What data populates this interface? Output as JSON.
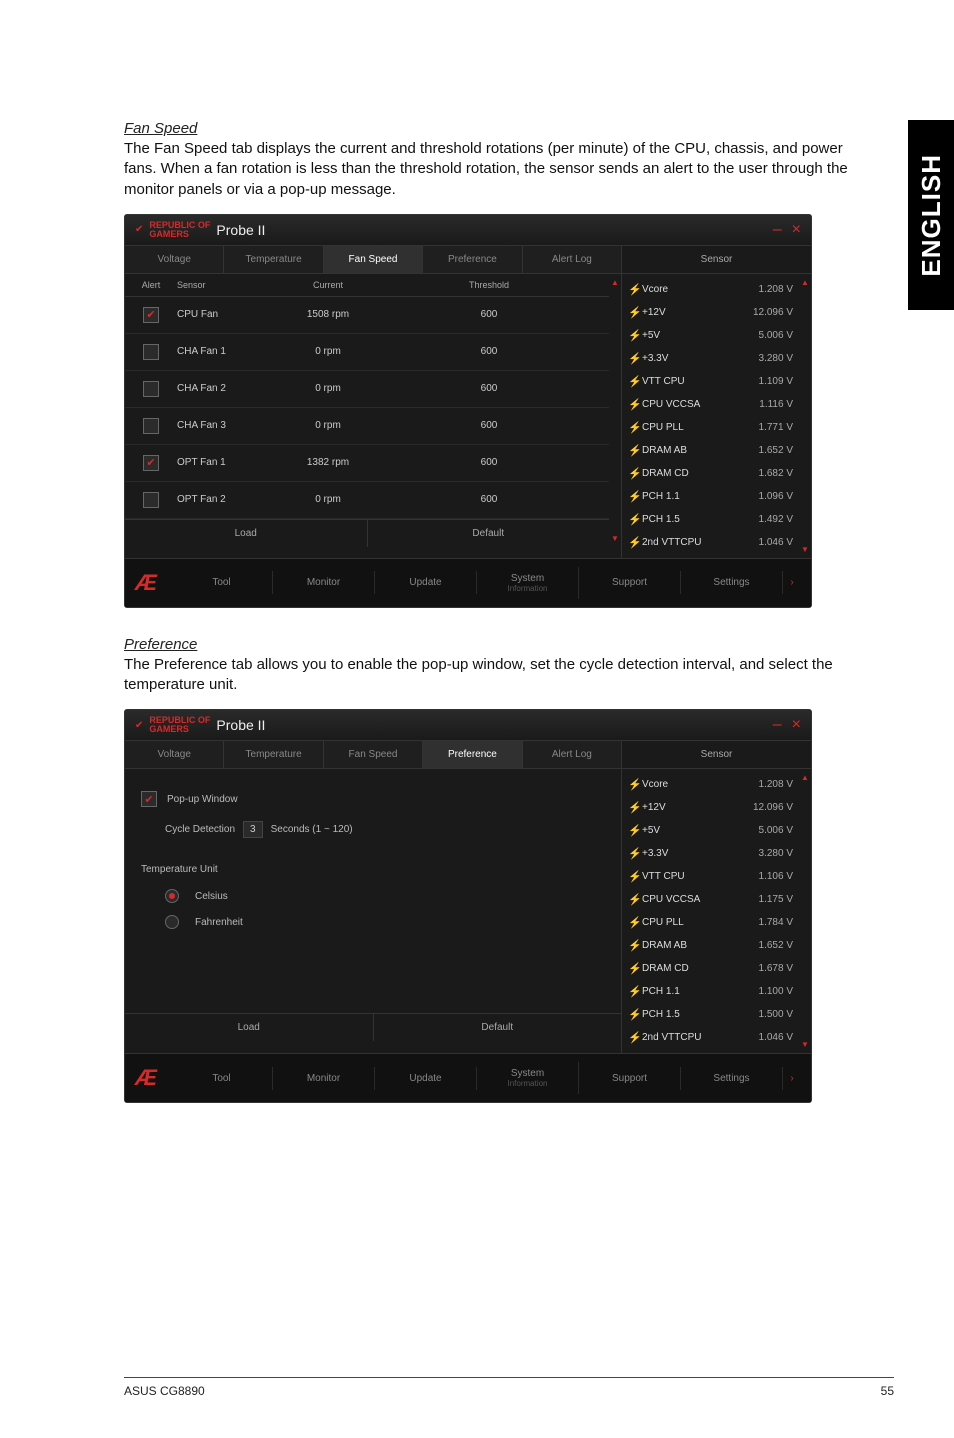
{
  "sidebar": {
    "label": "ENGLISH"
  },
  "fanSpeed": {
    "title": "Fan Speed",
    "description": "The Fan Speed tab displays the current and threshold rotations (per minute) of the CPU, chassis, and power fans. When a fan rotation is less than the threshold rotation, the sensor sends an alert to the user through the monitor panels or via a pop-up message."
  },
  "preference": {
    "title": "Preference",
    "description": "The Preference tab allows you to enable the pop-up window, set the cycle detection interval, and select the temperature unit."
  },
  "window": {
    "brand": "REPUBLIC OF\nGAMERS",
    "appTitle": "Probe II",
    "minLabel": "–",
    "closeLabel": "×"
  },
  "tabs": {
    "voltage": "Voltage",
    "temperature": "Temperature",
    "fanSpeed": "Fan Speed",
    "preference": "Preference",
    "alertLog": "Alert Log"
  },
  "fanGrid": {
    "headers": {
      "alert": "Alert",
      "sensor": "Sensor",
      "current": "Current",
      "threshold": "Threshold"
    },
    "rows": [
      {
        "checked": true,
        "sensor": "CPU Fan",
        "current": "1508 rpm",
        "threshold": "600"
      },
      {
        "checked": false,
        "sensor": "CHA Fan 1",
        "current": "0 rpm",
        "threshold": "600"
      },
      {
        "checked": false,
        "sensor": "CHA Fan 2",
        "current": "0 rpm",
        "threshold": "600"
      },
      {
        "checked": false,
        "sensor": "CHA Fan 3",
        "current": "0 rpm",
        "threshold": "600"
      },
      {
        "checked": true,
        "sensor": "OPT Fan 1",
        "current": "1382 rpm",
        "threshold": "600"
      },
      {
        "checked": false,
        "sensor": "OPT Fan 2",
        "current": "0 rpm",
        "threshold": "600"
      }
    ]
  },
  "bottomBtns": {
    "load": "Load",
    "default": "Default"
  },
  "sensorPanel": {
    "header": "Sensor",
    "items": [
      {
        "name": "Vcore",
        "val": "1.208 V"
      },
      {
        "name": "+12V",
        "val": "12.096 V"
      },
      {
        "name": "+5V",
        "val": "5.006 V"
      },
      {
        "name": "+3.3V",
        "val": "3.280 V"
      },
      {
        "name": "VTT CPU",
        "val": "1.109 V"
      },
      {
        "name": "CPU VCCSA",
        "val": "1.116 V"
      },
      {
        "name": "CPU PLL",
        "val": "1.771 V"
      },
      {
        "name": "DRAM AB",
        "val": "1.652 V"
      },
      {
        "name": "DRAM CD",
        "val": "1.682 V"
      },
      {
        "name": "PCH 1.1",
        "val": "1.096 V"
      },
      {
        "name": "PCH 1.5",
        "val": "1.492 V"
      },
      {
        "name": "2nd VTTCPU",
        "val": "1.046 V"
      }
    ]
  },
  "sensorPanel2": {
    "items": [
      {
        "name": "Vcore",
        "val": "1.208 V"
      },
      {
        "name": "+12V",
        "val": "12.096 V"
      },
      {
        "name": "+5V",
        "val": "5.006 V"
      },
      {
        "name": "+3.3V",
        "val": "3.280 V"
      },
      {
        "name": "VTT CPU",
        "val": "1.106 V"
      },
      {
        "name": "CPU VCCSA",
        "val": "1.175 V"
      },
      {
        "name": "CPU PLL",
        "val": "1.784 V"
      },
      {
        "name": "DRAM AB",
        "val": "1.652 V"
      },
      {
        "name": "DRAM CD",
        "val": "1.678 V"
      },
      {
        "name": "PCH 1.1",
        "val": "1.100 V"
      },
      {
        "name": "PCH 1.5",
        "val": "1.500 V"
      },
      {
        "name": "2nd VTTCPU",
        "val": "1.046 V"
      }
    ]
  },
  "prefPanel": {
    "popup": "Pop-up Window",
    "cycleLabel": "Cycle Detection",
    "cycleValue": "3",
    "cycleUnit": "Seconds (1 ~ 120)",
    "tempUnitHeader": "Temperature Unit",
    "celsius": "Celsius",
    "fahrenheit": "Fahrenheit"
  },
  "footer": {
    "tool": "Tool",
    "monitor": "Monitor",
    "update": "Update",
    "sysinfo": "System",
    "sysinfo2": "Information",
    "support": "Support",
    "settings": "Settings"
  },
  "pageFooter": {
    "left": "ASUS CG8890",
    "right": "55"
  }
}
